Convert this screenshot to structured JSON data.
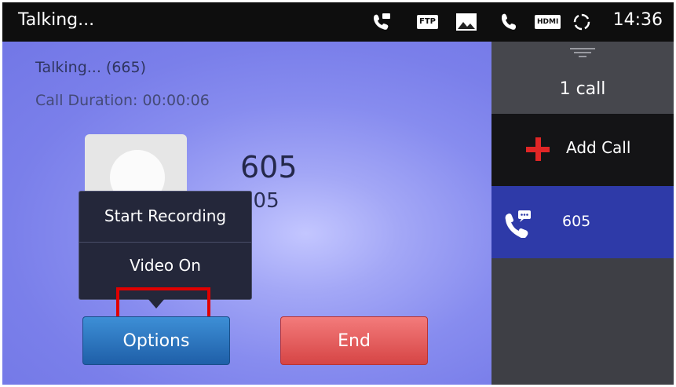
{
  "status_bar": {
    "title": "Talking...",
    "ftp_label": "FTP",
    "hdmi_label": "HDMI",
    "time": "14:36",
    "icons": [
      "call-message-icon",
      "ftp-icon",
      "image-icon",
      "phone-icon",
      "hdmi-icon",
      "sync-icon"
    ]
  },
  "call": {
    "status": "Talking... (665)",
    "duration": "Call Duration: 00:00:06",
    "caller_number": "605",
    "caller_sub": "605"
  },
  "options_menu": {
    "items": [
      {
        "label": "Start Recording"
      },
      {
        "label": "Video On"
      }
    ],
    "highlight_color": "#e00000"
  },
  "buttons": {
    "options_label": "Options",
    "end_label": "End"
  },
  "side_panel": {
    "calls_count": "1 call",
    "add_call_label": "Add Call",
    "call_entries": [
      {
        "label": "605"
      }
    ]
  },
  "colors": {
    "call_bg": "#7a7fea",
    "side_bg": "#3e3f45",
    "active_call_bg": "#2e3aa8",
    "options_button": "#2b74bf",
    "end_button": "#e05555",
    "add_icon": "#e02626"
  }
}
